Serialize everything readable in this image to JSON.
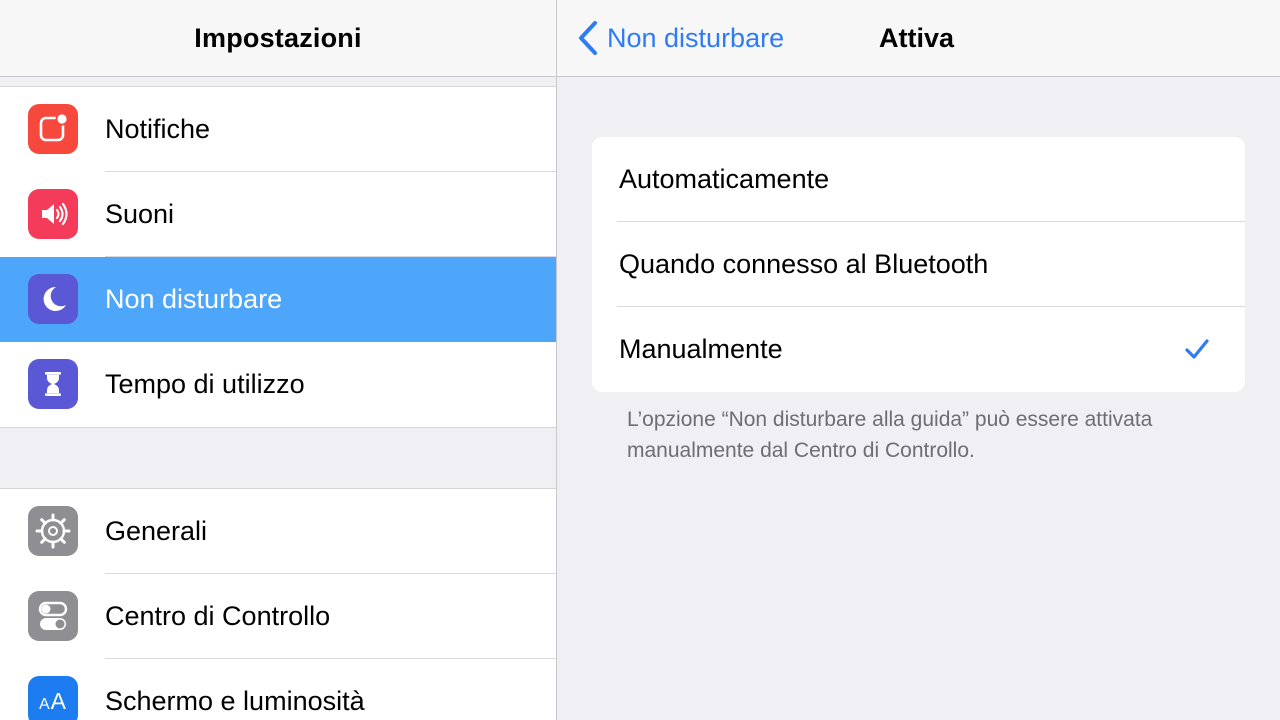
{
  "sidebar": {
    "title": "Impostazioni",
    "groups": [
      {
        "items": [
          {
            "label": "Notifiche",
            "icon": "notifications-icon",
            "color": "#f7483e"
          },
          {
            "label": "Suoni",
            "icon": "speaker-icon",
            "color": "#f53b5a"
          },
          {
            "label": "Non disturbare",
            "icon": "moon-icon",
            "color": "#5b58d6",
            "selected": true
          },
          {
            "label": "Tempo di utilizzo",
            "icon": "hourglass-icon",
            "color": "#5b58d6"
          }
        ]
      },
      {
        "items": [
          {
            "label": "Generali",
            "icon": "gear-icon",
            "color": "#8e8e93"
          },
          {
            "label": "Centro di Controllo",
            "icon": "toggles-icon",
            "color": "#8e8e93"
          },
          {
            "label": "Schermo e luminosità",
            "icon": "text-size-icon",
            "color": "#1c7cf0",
            "icon_text": "AA"
          }
        ]
      }
    ]
  },
  "detail": {
    "back_label": "Non disturbare",
    "title": "Attiva",
    "options": [
      {
        "label": "Automaticamente",
        "checked": false
      },
      {
        "label": "Quando connesso al Bluetooth",
        "checked": false
      },
      {
        "label": "Manualmente",
        "checked": true
      }
    ],
    "footer_note": "L’opzione “Non disturbare alla guida” può essere attivata manualmente dal Centro di Controllo."
  },
  "colors": {
    "accent": "#2f7bf5",
    "selection": "#4ea6fb",
    "background": "#efeff4"
  }
}
